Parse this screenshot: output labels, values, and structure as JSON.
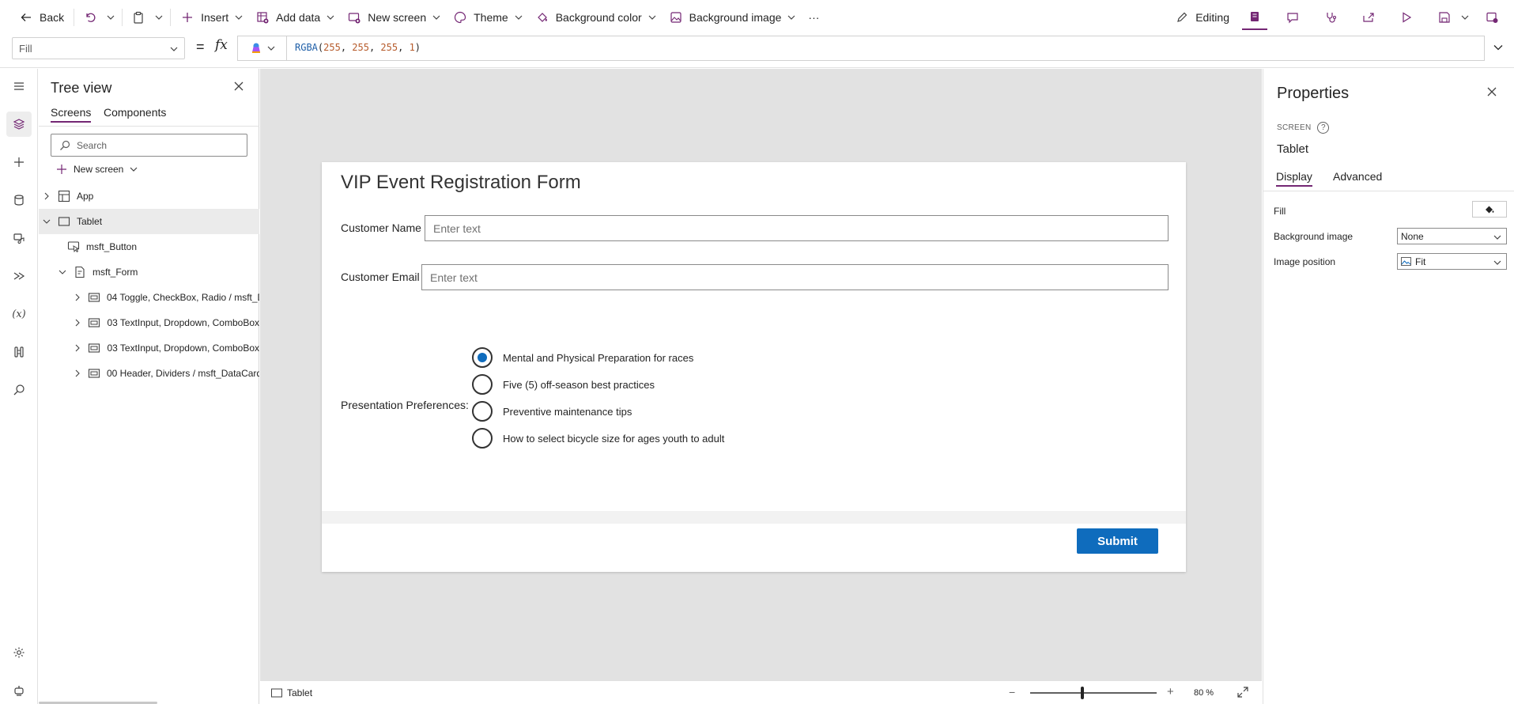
{
  "toolbar": {
    "back": "Back",
    "insert": "Insert",
    "add_data": "Add data",
    "new_screen": "New screen",
    "theme": "Theme",
    "background_color": "Background color",
    "background_image": "Background image",
    "more": "···",
    "editing": "Editing"
  },
  "formula_bar": {
    "property": "Fill",
    "equals": "=",
    "fx": "fx",
    "formula_fn": "RGBA",
    "formula_args": [
      "255",
      "255",
      "255",
      "1"
    ]
  },
  "tree_view": {
    "title": "Tree view",
    "tabs": [
      "Screens",
      "Components"
    ],
    "search_placeholder": "Search",
    "new_screen": "New screen",
    "nodes": [
      {
        "label": "App"
      },
      {
        "label": "Tablet"
      },
      {
        "label": "msft_Button"
      },
      {
        "label": "msft_Form"
      },
      {
        "label": "04 Toggle, CheckBox, Radio / msft_Da"
      },
      {
        "label": "03 TextInput, Dropdown, ComboBox"
      },
      {
        "label": "03 TextInput, Dropdown, ComboBox"
      },
      {
        "label": "00 Header, Dividers / msft_DataCard_"
      }
    ]
  },
  "form": {
    "title": "VIP Event Registration Form",
    "customer_name_label": "Customer Name",
    "customer_name_placeholder": "Enter text",
    "customer_email_label": "Customer Email",
    "customer_email_placeholder": "Enter text",
    "presentation_label": "Presentation Preferences:",
    "options": [
      {
        "label": "Mental and Physical Preparation for races",
        "selected": true
      },
      {
        "label": "Five (5) off-season best practices",
        "selected": false
      },
      {
        "label": "Preventive maintenance tips",
        "selected": false
      },
      {
        "label": "How to select bicycle size for ages youth to adult",
        "selected": false
      }
    ],
    "submit": "Submit"
  },
  "status_bar": {
    "screen": "Tablet",
    "zoom_minus": "−",
    "zoom_plus": "+",
    "zoom_value": "80  %"
  },
  "properties": {
    "title": "Properties",
    "caption": "SCREEN",
    "help": "?",
    "screen_name": "Tablet",
    "tabs": [
      "Display",
      "Advanced"
    ],
    "fill_label": "Fill",
    "background_image_label": "Background image",
    "background_image_value": "None",
    "image_position_label": "Image position",
    "image_position_value": "Fit"
  },
  "colors": {
    "accent": "#742774",
    "submit": "#0f6cbd",
    "canvas": "#e2e2e2"
  }
}
